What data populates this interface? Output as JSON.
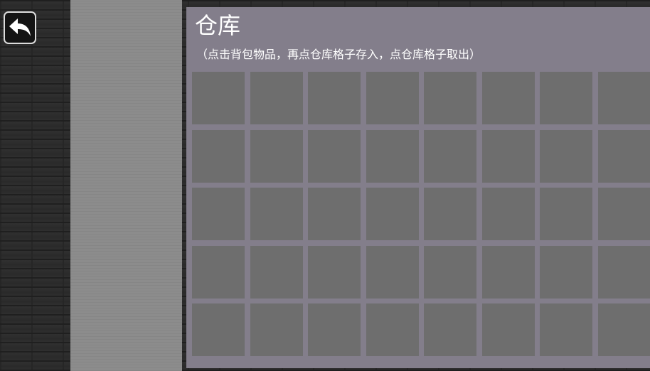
{
  "back_button": {
    "icon": "back-arrow-icon"
  },
  "side_panel": {
    "name": "backpack-panel"
  },
  "warehouse": {
    "title": "仓库",
    "hint": "（点击背包物品，再点仓库格子存入，点仓库格子取出）",
    "rows": 5,
    "columns": 8,
    "slots": [
      [
        {
          "item": ""
        },
        {
          "item": ""
        },
        {
          "item": ""
        },
        {
          "item": ""
        },
        {
          "item": ""
        },
        {
          "item": ""
        },
        {
          "item": ""
        },
        {
          "item": ""
        }
      ],
      [
        {
          "item": ""
        },
        {
          "item": ""
        },
        {
          "item": ""
        },
        {
          "item": ""
        },
        {
          "item": ""
        },
        {
          "item": ""
        },
        {
          "item": ""
        },
        {
          "item": ""
        }
      ],
      [
        {
          "item": ""
        },
        {
          "item": ""
        },
        {
          "item": ""
        },
        {
          "item": ""
        },
        {
          "item": ""
        },
        {
          "item": ""
        },
        {
          "item": ""
        },
        {
          "item": ""
        }
      ],
      [
        {
          "item": ""
        },
        {
          "item": ""
        },
        {
          "item": ""
        },
        {
          "item": ""
        },
        {
          "item": ""
        },
        {
          "item": ""
        },
        {
          "item": ""
        },
        {
          "item": ""
        }
      ],
      [
        {
          "item": ""
        },
        {
          "item": ""
        },
        {
          "item": ""
        },
        {
          "item": ""
        },
        {
          "item": ""
        },
        {
          "item": ""
        },
        {
          "item": ""
        },
        {
          "item": ""
        }
      ]
    ]
  },
  "colors": {
    "wall": "#2a2a2a",
    "side_panel": "#8a8a8a",
    "warehouse_panel": "#837e8b",
    "slot": "#6e6e6e",
    "text": "#ffffff"
  }
}
